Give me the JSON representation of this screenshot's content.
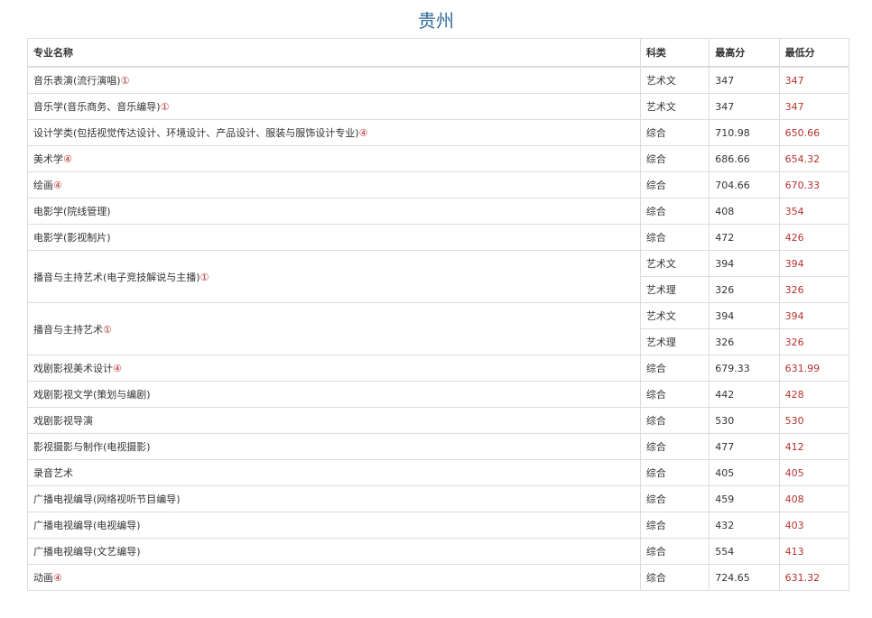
{
  "title": "贵州",
  "headers": [
    "专业名称",
    "科类",
    "最高分",
    "最低分"
  ],
  "rows": [
    {
      "name": "音乐表演(流行演唱)",
      "mark": "①",
      "entries": [
        {
          "type": "艺术文",
          "max": "347",
          "min": "347"
        }
      ]
    },
    {
      "name": "音乐学(音乐商务、音乐编导)",
      "mark": "①",
      "entries": [
        {
          "type": "艺术文",
          "max": "347",
          "min": "347"
        }
      ]
    },
    {
      "name": "设计学类(包括视觉传达设计、环境设计、产品设计、服装与服饰设计专业)",
      "mark": "④",
      "entries": [
        {
          "type": "综合",
          "max": "710.98",
          "min": "650.66"
        }
      ]
    },
    {
      "name": "美术学",
      "mark": "④",
      "entries": [
        {
          "type": "综合",
          "max": "686.66",
          "min": "654.32"
        }
      ]
    },
    {
      "name": "绘画",
      "mark": "④",
      "entries": [
        {
          "type": "综合",
          "max": "704.66",
          "min": "670.33"
        }
      ]
    },
    {
      "name": "电影学(院线管理)",
      "mark": "",
      "entries": [
        {
          "type": "综合",
          "max": "408",
          "min": "354"
        }
      ]
    },
    {
      "name": "电影学(影视制片)",
      "mark": "",
      "entries": [
        {
          "type": "综合",
          "max": "472",
          "min": "426"
        }
      ]
    },
    {
      "name": "播音与主持艺术(电子竞技解说与主播)",
      "mark": "①",
      "entries": [
        {
          "type": "艺术文",
          "max": "394",
          "min": "394"
        },
        {
          "type": "艺术理",
          "max": "326",
          "min": "326"
        }
      ]
    },
    {
      "name": "播音与主持艺术",
      "mark": "①",
      "entries": [
        {
          "type": "艺术文",
          "max": "394",
          "min": "394"
        },
        {
          "type": "艺术理",
          "max": "326",
          "min": "326"
        }
      ]
    },
    {
      "name": "戏剧影视美术设计",
      "mark": "④",
      "entries": [
        {
          "type": "综合",
          "max": "679.33",
          "min": "631.99"
        }
      ]
    },
    {
      "name": "戏剧影视文学(策划与编剧)",
      "mark": "",
      "entries": [
        {
          "type": "综合",
          "max": "442",
          "min": "428"
        }
      ]
    },
    {
      "name": "戏剧影视导演",
      "mark": "",
      "entries": [
        {
          "type": "综合",
          "max": "530",
          "min": "530"
        }
      ]
    },
    {
      "name": "影视摄影与制作(电视摄影)",
      "mark": "",
      "entries": [
        {
          "type": "综合",
          "max": "477",
          "min": "412"
        }
      ]
    },
    {
      "name": "录音艺术",
      "mark": "",
      "entries": [
        {
          "type": "综合",
          "max": "405",
          "min": "405"
        }
      ]
    },
    {
      "name": "广播电视编导(网络视听节目编导)",
      "mark": "",
      "entries": [
        {
          "type": "综合",
          "max": "459",
          "min": "408"
        }
      ]
    },
    {
      "name": "广播电视编导(电视编导)",
      "mark": "",
      "entries": [
        {
          "type": "综合",
          "max": "432",
          "min": "403"
        }
      ]
    },
    {
      "name": "广播电视编导(文艺编导)",
      "mark": "",
      "entries": [
        {
          "type": "综合",
          "max": "554",
          "min": "413"
        }
      ]
    },
    {
      "name": "动画",
      "mark": "④",
      "entries": [
        {
          "type": "综合",
          "max": "724.65",
          "min": "631.32"
        }
      ]
    }
  ]
}
